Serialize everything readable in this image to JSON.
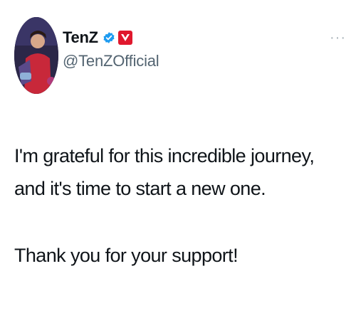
{
  "author": {
    "display_name": "TenZ",
    "handle": "@TenZOfficial",
    "verified_icon": "verified-badge-icon",
    "affiliate_icon": "team-affiliate-badge-icon",
    "verified_color": "#1d9bf0",
    "affiliate_color": "#e0182d"
  },
  "menu": {
    "more_label": "···"
  },
  "tweet": {
    "lines": [
      "I'm grateful for this incredible journey, and it's time to start a new one.",
      "Thank you for your support!"
    ]
  }
}
